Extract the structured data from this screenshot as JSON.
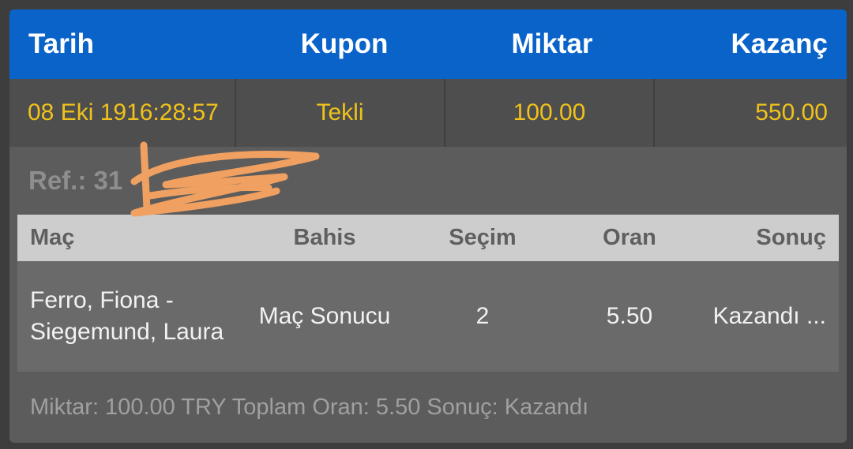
{
  "header": {
    "date_label": "Tarih",
    "coupon_label": "Kupon",
    "amount_label": "Miktar",
    "winnings_label": "Kazanç"
  },
  "summary": {
    "date": "08 Eki 19",
    "time": "16:28:57",
    "coupon_type": "Tekli",
    "amount": "100.00",
    "winnings": "550.00"
  },
  "ref": {
    "label": "Ref.: 31"
  },
  "table": {
    "columns": [
      "Maç",
      "Bahis",
      "Seçim",
      "Oran",
      "Sonuç"
    ],
    "rows": [
      {
        "match": "Ferro, Fiona - Siegemund, Laura",
        "bet": "Maç Sonucu",
        "selection": "2",
        "odds": "5.50",
        "result": "Kazandı ..."
      }
    ]
  },
  "footer": {
    "text": "Miktar: 100.00 TRY Toplam Oran: 5.50 Sonuç: Kazandı"
  },
  "colors": {
    "header_bg": "#0a63c9",
    "accent_yellow": "#f0c21a",
    "scribble_orange": "#f0a060"
  }
}
